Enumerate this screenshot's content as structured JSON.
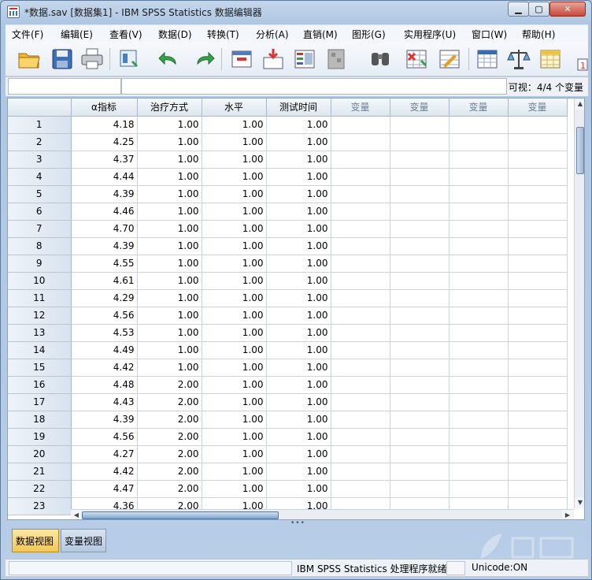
{
  "window": {
    "title": "*数据.sav [数据集1] - IBM SPSS Statistics 数据编辑器"
  },
  "menu": [
    "文件(F)",
    "编辑(E)",
    "查看(V)",
    "数据(D)",
    "转换(T)",
    "分析(A)",
    "直销(M)",
    "图形(G)",
    "实用程序(U)",
    "窗口(W)",
    "帮助(H)"
  ],
  "toolbar": {
    "icons": [
      "open-folder-icon",
      "save-icon",
      "print-icon",
      "dialog-recall-icon",
      "undo-icon",
      "redo-icon",
      "goto-case-icon",
      "goto-variable-icon",
      "variables-icon",
      "split-file-icon",
      "find-icon",
      "insert-cases-icon",
      "insert-variable-icon",
      "weight-cases-icon",
      "select-cases-icon",
      "value-labels-icon"
    ]
  },
  "editbar": {
    "cell_ref": "",
    "cell_value": "",
    "visible_count": "可视：4/4 个变量"
  },
  "grid": {
    "columns": [
      "α指标",
      "治疗方式",
      "水平",
      "测试时间",
      "变量",
      "变量",
      "变量",
      "变量"
    ],
    "rows": [
      [
        "1",
        "4.18",
        "1.00",
        "1.00",
        "1.00"
      ],
      [
        "2",
        "4.25",
        "1.00",
        "1.00",
        "1.00"
      ],
      [
        "3",
        "4.37",
        "1.00",
        "1.00",
        "1.00"
      ],
      [
        "4",
        "4.44",
        "1.00",
        "1.00",
        "1.00"
      ],
      [
        "5",
        "4.39",
        "1.00",
        "1.00",
        "1.00"
      ],
      [
        "6",
        "4.46",
        "1.00",
        "1.00",
        "1.00"
      ],
      [
        "7",
        "4.70",
        "1.00",
        "1.00",
        "1.00"
      ],
      [
        "8",
        "4.39",
        "1.00",
        "1.00",
        "1.00"
      ],
      [
        "9",
        "4.55",
        "1.00",
        "1.00",
        "1.00"
      ],
      [
        "10",
        "4.61",
        "1.00",
        "1.00",
        "1.00"
      ],
      [
        "11",
        "4.29",
        "1.00",
        "1.00",
        "1.00"
      ],
      [
        "12",
        "4.56",
        "1.00",
        "1.00",
        "1.00"
      ],
      [
        "13",
        "4.53",
        "1.00",
        "1.00",
        "1.00"
      ],
      [
        "14",
        "4.49",
        "1.00",
        "1.00",
        "1.00"
      ],
      [
        "15",
        "4.42",
        "1.00",
        "1.00",
        "1.00"
      ],
      [
        "16",
        "4.48",
        "2.00",
        "1.00",
        "1.00"
      ],
      [
        "17",
        "4.43",
        "2.00",
        "1.00",
        "1.00"
      ],
      [
        "18",
        "4.39",
        "2.00",
        "1.00",
        "1.00"
      ],
      [
        "19",
        "4.56",
        "2.00",
        "1.00",
        "1.00"
      ],
      [
        "20",
        "4.27",
        "2.00",
        "1.00",
        "1.00"
      ],
      [
        "21",
        "4.42",
        "2.00",
        "1.00",
        "1.00"
      ],
      [
        "22",
        "4.47",
        "2.00",
        "1.00",
        "1.00"
      ],
      [
        "23",
        "4.36",
        "2.00",
        "1.00",
        "1.00"
      ]
    ]
  },
  "tabs": {
    "data_view": "数据视图",
    "variable_view": "变量视图"
  },
  "status": {
    "processor": "IBM SPSS Statistics 处理程序就绪",
    "unicode": "Unicode:ON"
  },
  "colors": {
    "active_tab": "#f1c757",
    "title_bar": "#c5d7ec"
  }
}
